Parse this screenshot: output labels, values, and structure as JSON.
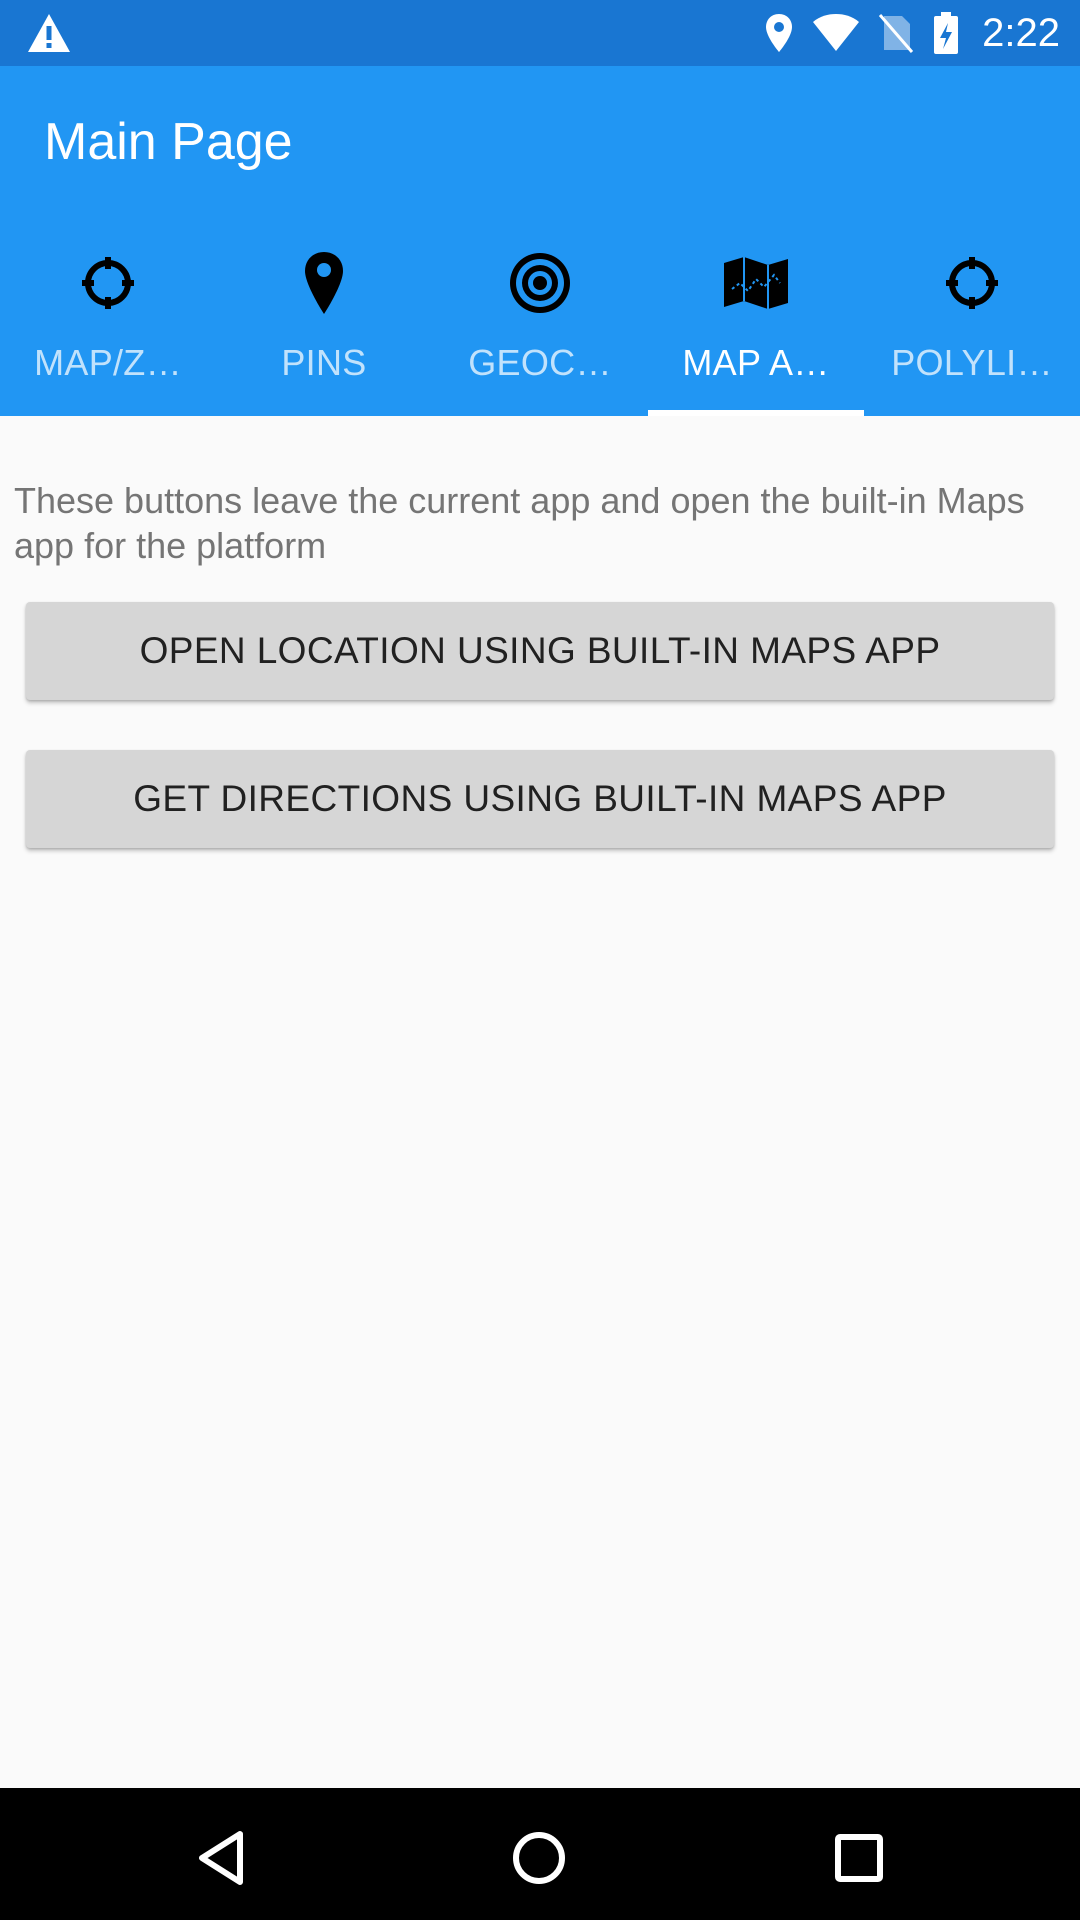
{
  "status_bar": {
    "time": "2:22",
    "icons": [
      "warning-icon",
      "location-icon",
      "wifi-icon",
      "no-sim-icon",
      "battery-charging-icon"
    ]
  },
  "toolbar": {
    "title": "Main Page"
  },
  "tabs": [
    {
      "label": "MAP/Z…",
      "icon": "crosshair-icon",
      "active": false
    },
    {
      "label": "PINS",
      "icon": "pin-icon",
      "active": false
    },
    {
      "label": "GEOC…",
      "icon": "target-icon",
      "active": false
    },
    {
      "label": "MAP A…",
      "icon": "map-icon",
      "active": true
    },
    {
      "label": "POLYLI…",
      "icon": "crosshair-icon",
      "active": false
    }
  ],
  "content": {
    "description": "These buttons leave the current app and open the built-in Maps app for the platform",
    "open_location_button": "OPEN LOCATION USING BUILT-IN MAPS APP",
    "get_directions_button": "GET DIRECTIONS USING BUILT-IN MAPS APP"
  },
  "nav_bar": {
    "icons": [
      "back-icon",
      "home-icon",
      "recents-icon"
    ]
  },
  "colors": {
    "status_bar": "#1976D2",
    "toolbar": "#2196F3",
    "background": "#FAFAFA",
    "button": "#D6D6D6"
  }
}
